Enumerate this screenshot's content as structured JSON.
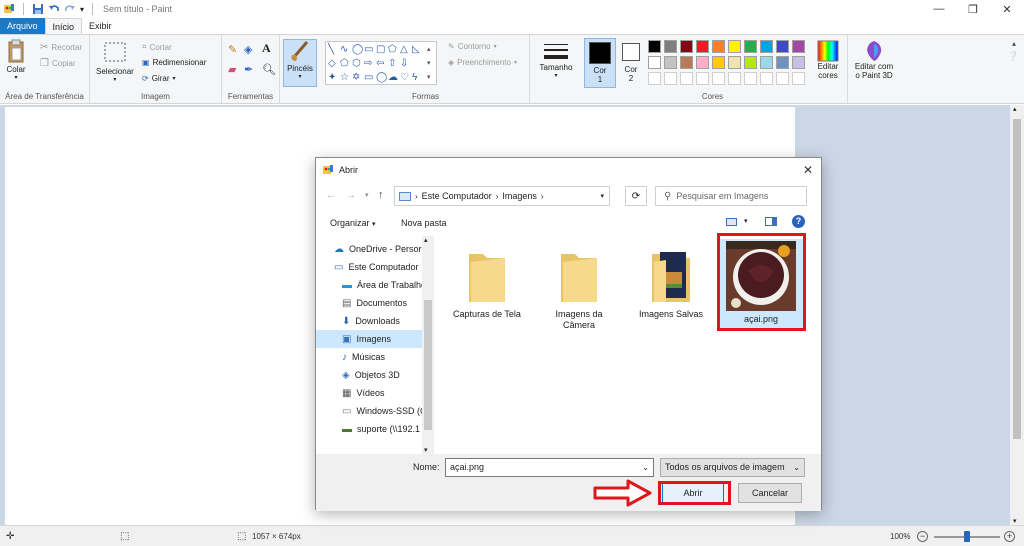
{
  "app": {
    "title": "Sem título - Paint"
  },
  "tabs": [
    {
      "label": "Arquivo"
    },
    {
      "label": "Início"
    },
    {
      "label": "Exibir"
    }
  ],
  "ribbon": {
    "clipboard": {
      "paste": "Colar",
      "cut": "Recortar",
      "copy": "Copiar",
      "label": "Área de Transferência"
    },
    "image": {
      "select": "Selecionar",
      "crop": "Cortar",
      "resize": "Redimensionar",
      "rotate": "Girar",
      "label": "Imagem"
    },
    "tools": {
      "label": "Ferramentas"
    },
    "brushes": {
      "label": "Pincéis"
    },
    "shapes": {
      "outline": "Contorno",
      "fill": "Preenchimento",
      "label": "Formas"
    },
    "size": {
      "label": "Tamanho"
    },
    "colors": {
      "color1": "Cor 1",
      "color1_a": "Cor",
      "color1_b": "1",
      "color2_a": "Cor",
      "color2_b": "2",
      "edit_a": "Editar",
      "edit_b": "cores",
      "label": "Cores",
      "row1": [
        "#000000",
        "#7f7f7f",
        "#880015",
        "#ed1c24",
        "#ff7f27",
        "#fff200",
        "#22b14c",
        "#00a2e8",
        "#3f48cc",
        "#a349a4"
      ],
      "row2": [
        "#ffffff",
        "#c3c3c3",
        "#b97a57",
        "#ffaec9",
        "#ffc90e",
        "#efe4b0",
        "#b5e61d",
        "#99d9ea",
        "#7092be",
        "#c8bfe7"
      ]
    },
    "paint3d": {
      "a": "Editar com",
      "b": "o Paint 3D"
    }
  },
  "statusbar": {
    "dimensions": "1057 × 674px",
    "zoom": "100%",
    "zoom_level": 0.5
  },
  "dialog": {
    "title": "Abrir",
    "breadcrumb": [
      "Este Computador",
      "Imagens"
    ],
    "search_placeholder": "Pesquisar em Imagens",
    "organize": "Organizar",
    "new_folder": "Nova pasta",
    "nav_items": [
      {
        "label": "OneDrive - Persor",
        "icon": "cloud-icon"
      },
      {
        "label": "Este Computador",
        "icon": "computer-icon"
      },
      {
        "label": "Área de Trabalho",
        "icon": "desktop-icon"
      },
      {
        "label": "Documentos",
        "icon": "document-icon"
      },
      {
        "label": "Downloads",
        "icon": "download-icon"
      },
      {
        "label": "Imagens",
        "icon": "pictures-icon"
      },
      {
        "label": "Músicas",
        "icon": "music-icon"
      },
      {
        "label": "Objetos 3D",
        "icon": "cube-icon"
      },
      {
        "label": "Vídeos",
        "icon": "video-icon"
      },
      {
        "label": "Windows-SSD (C",
        "icon": "drive-icon"
      },
      {
        "label": "suporte (\\\\192.1",
        "icon": "network-drive-icon"
      }
    ],
    "files": [
      {
        "label": "Capturas de Tela",
        "type": "folder"
      },
      {
        "label": "Imagens da Câmera",
        "line1": "Imagens da",
        "line2": "Câmera",
        "type": "folder"
      },
      {
        "label": "Imagens Salvas",
        "type": "folder-with-image"
      },
      {
        "label": "açai.png",
        "type": "image"
      }
    ],
    "filename_label": "Nome:",
    "filename_value": "açai.png",
    "filetype": "Todos os arquivos de imagem",
    "open_button": "Abrir",
    "cancel_button": "Cancelar"
  }
}
